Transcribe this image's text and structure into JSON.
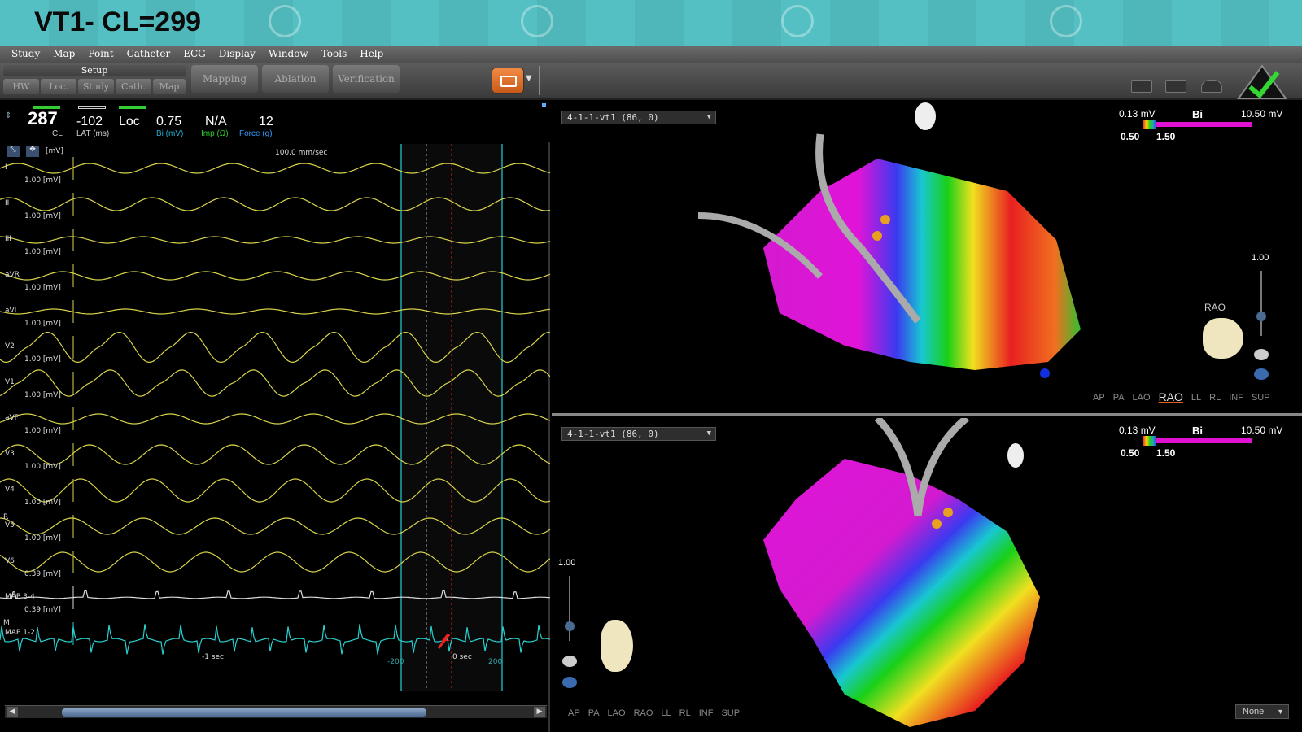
{
  "banner": {
    "title": "VT1-  CL=299"
  },
  "menu": [
    "Study",
    "Map",
    "Point",
    "Catheter",
    "ECG",
    "Display",
    "Window",
    "Tools",
    "Help"
  ],
  "toolbar": {
    "setup_label": "Setup",
    "setup_tabs": [
      "HW",
      "Loc.",
      "Study",
      "Cath.",
      "Map"
    ],
    "phase_tabs": [
      "Mapping",
      "Ablation",
      "Verification"
    ]
  },
  "metrics": {
    "cl": {
      "value": "287",
      "unit": "CL"
    },
    "lat": {
      "value": "-102",
      "unit": "LAT (ms)"
    },
    "loc": {
      "value": "Loc",
      "unit": ""
    },
    "bi": {
      "value": "0.75",
      "unit": "Bi (mV)"
    },
    "imp": {
      "value": "N/A",
      "unit": "Imp (Ω)"
    },
    "force": {
      "value": "12",
      "unit": "Force (g)"
    }
  },
  "ecg": {
    "units_label": "[mV]",
    "sweep_speed": "100.0 mm/sec",
    "leads": [
      {
        "name": "I",
        "gain": "1.00  [mV]"
      },
      {
        "name": "II",
        "gain": "1.00  [mV]"
      },
      {
        "name": "III",
        "gain": "1.00  [mV]"
      },
      {
        "name": "aVR",
        "gain": "1.00  [mV]"
      },
      {
        "name": "aVL",
        "gain": "1.00  [mV]"
      },
      {
        "name": "V2",
        "gain": "1.00  [mV]"
      },
      {
        "name": "V1",
        "gain": "1.00  [mV]"
      },
      {
        "name": "aVF",
        "gain": "1.00  [mV]"
      },
      {
        "name": "V3",
        "gain": "1.00  [mV]"
      },
      {
        "name": "V4",
        "gain": "1.00  [mV]"
      },
      {
        "name": "V5",
        "gain": "1.00  [mV]"
      },
      {
        "name": "V6",
        "gain": "0.39  [mV]"
      },
      {
        "name": "MAP 3-4",
        "gain": "0.39  [mV]"
      },
      {
        "name": "MAP 1-2",
        "gain": ""
      }
    ],
    "side_markers": [
      "R",
      "M"
    ],
    "time_labels": {
      "minus1": "-1 sec",
      "minus200": "-200",
      "zero": "0 sec",
      "plus200": "200"
    }
  },
  "maps": [
    {
      "selector": "4-1-1-vt1 (86, 0)",
      "scale": {
        "low": "0.13 mV",
        "mode": "Bi",
        "high": "10.50 mV",
        "thr_low": "0.50",
        "thr_high": "1.50"
      },
      "zoom": "1.00",
      "orientation": "RAO",
      "views": [
        "AP",
        "PA",
        "LAO",
        "RAO",
        "LL",
        "RL",
        "INF",
        "SUP"
      ],
      "selected_view": "RAO"
    },
    {
      "selector": "4-1-1-vt1 (86, 0)",
      "scale": {
        "low": "0.13 mV",
        "mode": "Bi",
        "high": "10.50 mV",
        "thr_low": "0.50",
        "thr_high": "1.50"
      },
      "zoom": "1.00",
      "views": [
        "AP",
        "PA",
        "LAO",
        "RAO",
        "LL",
        "RL",
        "INF",
        "SUP"
      ],
      "dropdown": "None"
    }
  ],
  "colors": {
    "ecg_trace": "#d8d44a",
    "map_trace": "#2ad0d0",
    "accent_orange": "#e87530",
    "magenta": "#e011d0",
    "banner": "#55c0c3"
  }
}
